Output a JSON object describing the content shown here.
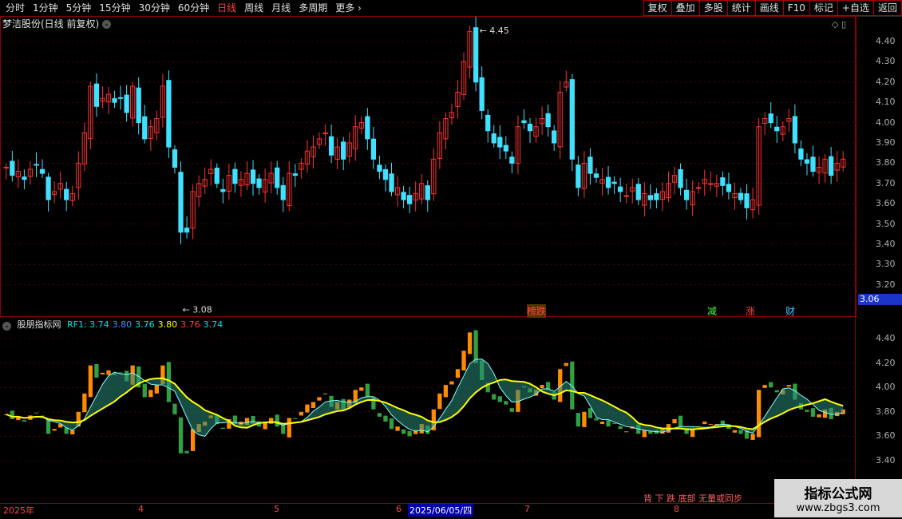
{
  "toolbar": {
    "periods": [
      "分时",
      "1分钟",
      "5分钟",
      "15分钟",
      "30分钟",
      "60分钟",
      "日线",
      "周线",
      "月线",
      "多周期",
      "更多"
    ],
    "active_period": "日线",
    "right_buttons": [
      "复权",
      "叠加",
      "多股",
      "统计",
      "画线",
      "F10",
      "标记",
      "+自选",
      "返回"
    ]
  },
  "stock": {
    "title": "梦洁股份(日线 前复权)"
  },
  "price_axis": [
    "4.40",
    "4.30",
    "4.20",
    "4.10",
    "4.00",
    "3.90",
    "3.80",
    "3.70",
    "3.60",
    "3.50",
    "3.40",
    "3.30",
    "3.20"
  ],
  "current_price": "3.06",
  "annotations": {
    "high": "4.45",
    "low": "3.08"
  },
  "markers": [
    {
      "text": "榜跌",
      "color": "#ff4444",
      "bg": "#553300"
    },
    {
      "text": "减",
      "color": "#40ff40"
    },
    {
      "text": "涨",
      "color": "#ff4444"
    },
    {
      "text": "财",
      "color": "#40c0ff"
    }
  ],
  "indicator": {
    "name": "股朋指标网",
    "values": [
      {
        "text": "RF1: 3.74",
        "color": "#00e0e0"
      },
      {
        "text": "3.80",
        "color": "#4090ff"
      },
      {
        "text": "3.76",
        "color": "#00e0e0"
      },
      {
        "text": "3.80",
        "color": "#ffff00"
      },
      {
        "text": "3.76",
        "color": "#ff4040"
      },
      {
        "text": "3.74",
        "color": "#00e0e0"
      }
    ],
    "axis": [
      "4.40",
      "4.20",
      "4.00",
      "3.80",
      "3.60",
      "3.40"
    ]
  },
  "dates": [
    {
      "text": "2025年"
    },
    {
      "text": "4"
    },
    {
      "text": "5"
    },
    {
      "text": "6"
    },
    {
      "text": "2025/06/05/四",
      "selected": true
    },
    {
      "text": "7"
    },
    {
      "text": "8"
    }
  ],
  "bottom_legend": "背 下 跌 底部 无量或同步",
  "watermark": {
    "line1": "指标公式网",
    "line2": "www.zbgs3.com"
  }
}
